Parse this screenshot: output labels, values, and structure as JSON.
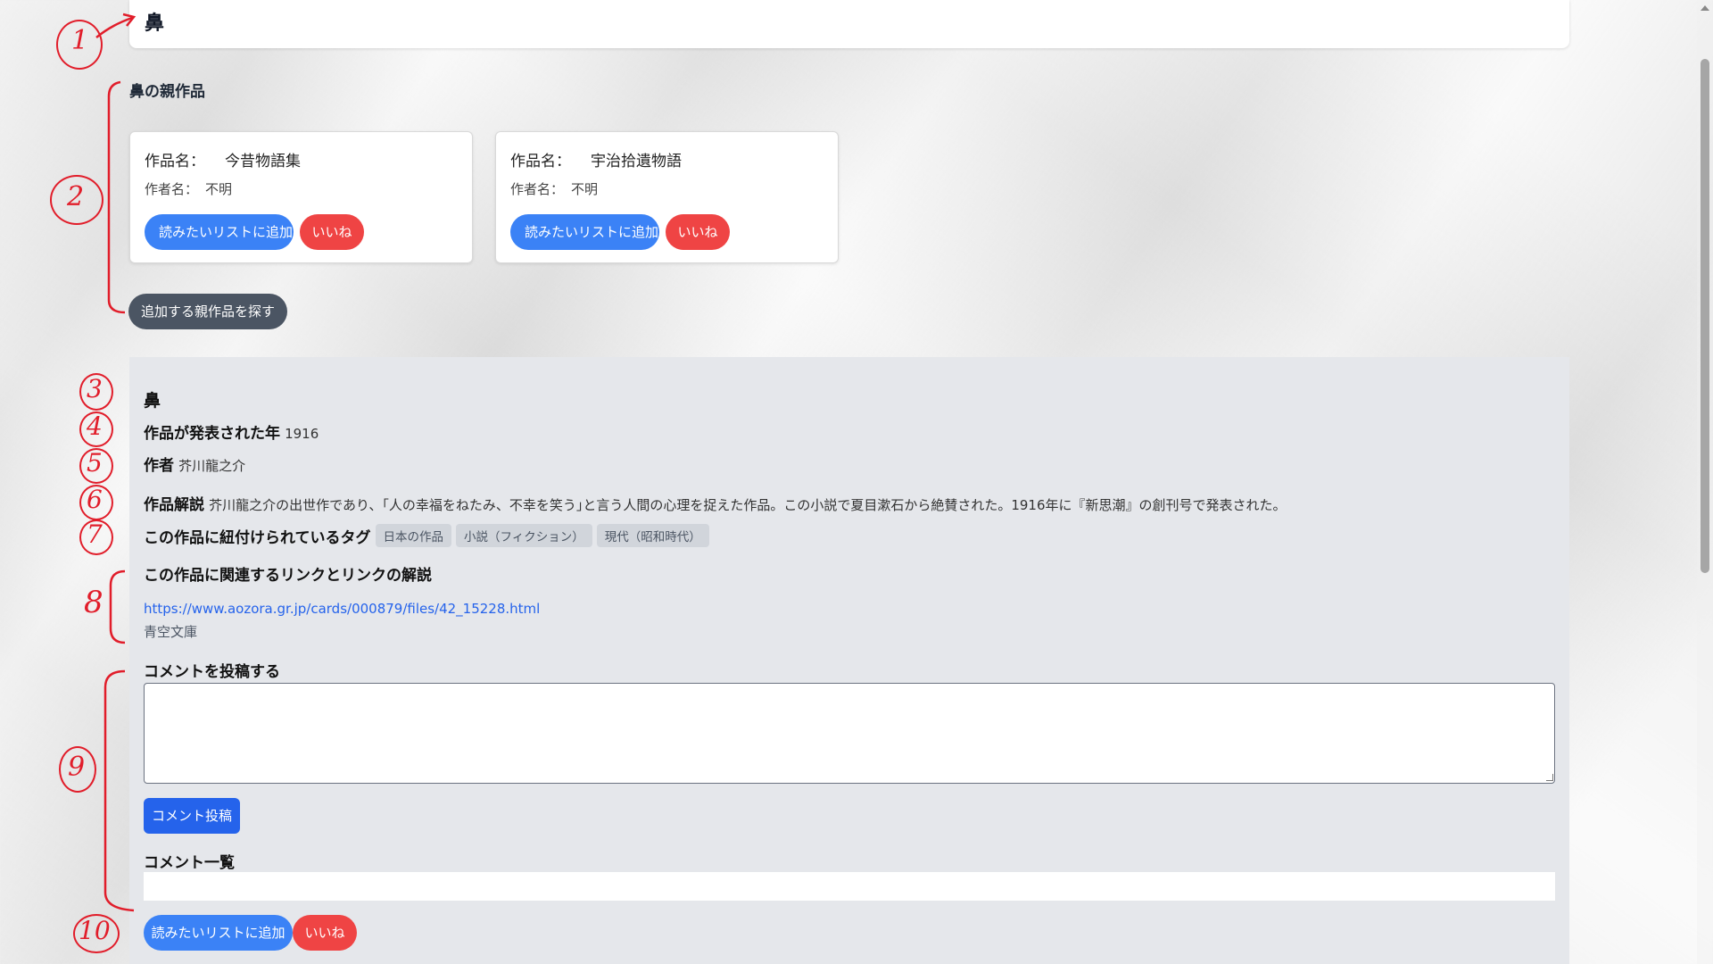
{
  "header": {
    "title": "鼻"
  },
  "parents": {
    "heading": "鼻の親作品",
    "cards": [
      {
        "work_label": "作品名：",
        "work_name": "今昔物語集",
        "author_label": "作者名：",
        "author_name": "不明",
        "add_label": "読みたいリストに追加",
        "like_label": "いいね"
      },
      {
        "work_label": "作品名：",
        "work_name": "宇治拾遺物語",
        "author_label": "作者名：",
        "author_name": "不明",
        "add_label": "読みたいリストに追加",
        "like_label": "いいね"
      }
    ],
    "find_button": "追加する親作品を探す"
  },
  "detail": {
    "title": "鼻",
    "year_label": "作品が発表された年",
    "year_value": "1916",
    "author_label": "作者",
    "author_value": "芥川龍之介",
    "desc_label": "作品解説",
    "desc_value": "芥川龍之介の出世作であり、｢人の幸福をねたみ、不幸を笑う｣と言う人間の心理を捉えた作品。この小説で夏目漱石から絶賛された。1916年に『新思潮』の創刊号で発表された。",
    "tags_label": "この作品に紐付けられているタグ",
    "tags": [
      "日本の作品",
      "小説（フィクション）",
      "現代（昭和時代）"
    ],
    "links_heading": "この作品に関連するリンクとリンクの解説",
    "link_url": "https://www.aozora.gr.jp/cards/000879/files/42_15228.html",
    "link_desc": "青空文庫",
    "comment_heading": "コメントを投稿する",
    "comment_value": "",
    "comment_post_button": "コメント投稿",
    "comment_list_heading": "コメント一覧",
    "add_label": "読みたいリストに追加",
    "like_label": "いいね"
  },
  "annotations": [
    "1",
    "2",
    "3",
    "4",
    "5",
    "6",
    "7",
    "8",
    "9",
    "10"
  ],
  "colors": {
    "accent_blue": "#3b82f6",
    "like_red": "#ef4444",
    "annotation_red": "#e11d2a",
    "panel_gray": "#e5e7eb"
  }
}
